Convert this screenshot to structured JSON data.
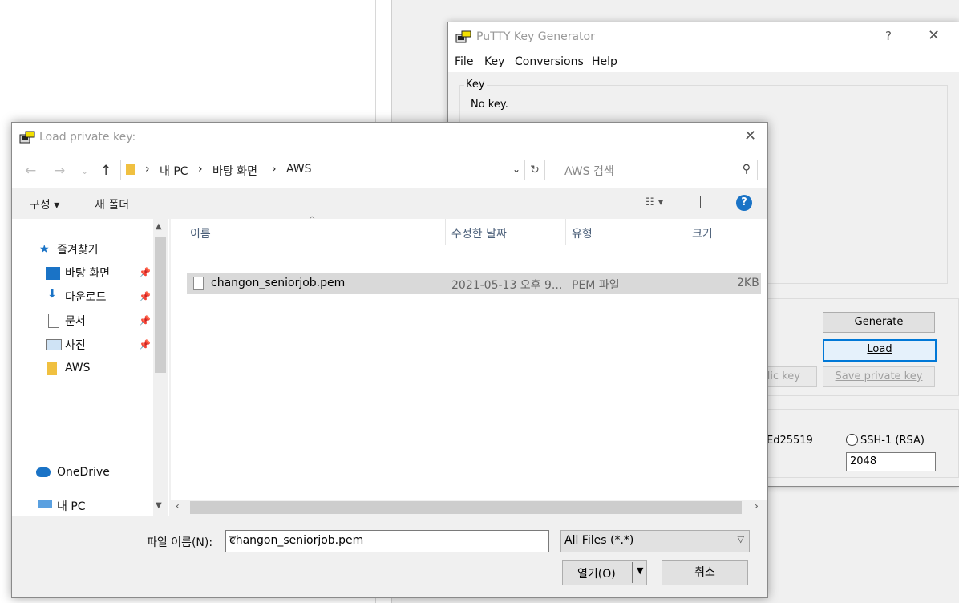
{
  "putty": {
    "title": "PuTTY Key Generator",
    "help_glyph": "?",
    "close_glyph": "✕",
    "menu": [
      "File",
      "Key",
      "Conversions",
      "Help"
    ],
    "key_group_label": "Key",
    "no_key_text": "No key.",
    "generate_label": "Generate",
    "load_label": "Load",
    "save_public_label": "lic key",
    "save_private_label": "Save private key",
    "ed25519_label": "Ed25519",
    "ssh1_label": "SSH-1 (RSA)",
    "bits_value": "2048"
  },
  "dialog": {
    "title": "Load private key:",
    "close_glyph": "✕",
    "breadcrumb": [
      "내 PC",
      "바탕 화면",
      "AWS"
    ],
    "search_placeholder": "AWS 검색",
    "organize_label": "구성",
    "new_folder_label": "새 폴더",
    "nav": {
      "quick_access": "즐겨찾기",
      "items": [
        "바탕 화면",
        "다운로드",
        "문서",
        "사진",
        "AWS"
      ],
      "onedrive": "OneDrive",
      "this_pc": "내 PC"
    },
    "columns": [
      "이름",
      "수정한 날짜",
      "유형",
      "크기"
    ],
    "files": [
      {
        "name": "changon_seniorjob.pem",
        "modified": "2021-05-13 오후 9...",
        "type": "PEM 파일",
        "size": "2KB"
      }
    ],
    "filename_label": "파일 이름(N):",
    "filename_value": "changon_seniorjob.pem",
    "filetype_value": "All Files (*.*)",
    "open_label": "열기(O)",
    "cancel_label": "취소"
  },
  "colors": {
    "accent": "#0078d7",
    "selection": "#d9d9d9",
    "help_blue": "#1a73c6",
    "folder_yellow": "#f0c040"
  }
}
